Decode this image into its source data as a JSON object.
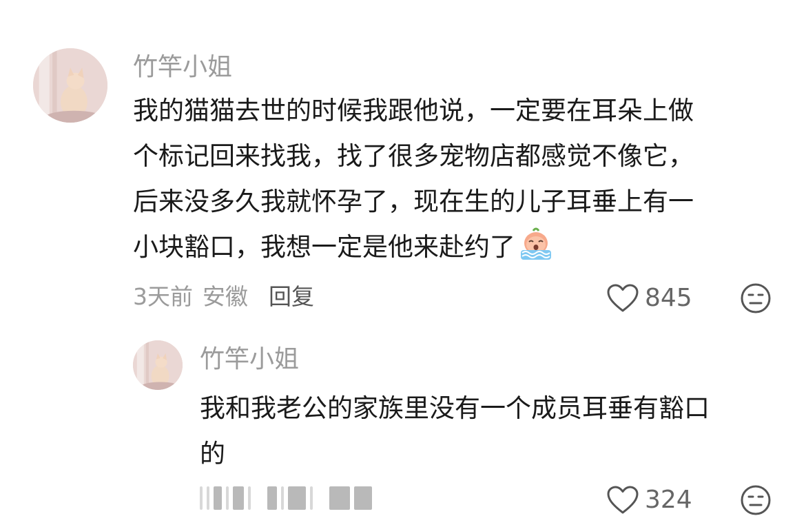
{
  "comment": {
    "username": "竹竿小姐",
    "lines": [
      "我的猫猫去世的时候我跟他说，一定要在耳朵上做",
      "个标记回来找我，找了很多宠物店都感觉不像它，",
      "后来没多久我就怀孕了，现在生的儿子耳垂上有一",
      "小块豁口，我想一定是他来赴约了"
    ],
    "emoji": "crying-face-emoji",
    "time": "3天前",
    "location": "安徽",
    "reply_label": "回复",
    "likes": "845"
  },
  "reply": {
    "username": "竹竿小姐",
    "lines": [
      "我和我老公的家族里没有一个成员耳垂有豁口",
      "的"
    ],
    "likes": "324"
  },
  "colors": {
    "text": "#1a1a1a",
    "muted": "#9b9b9b",
    "icon": "#666666"
  }
}
